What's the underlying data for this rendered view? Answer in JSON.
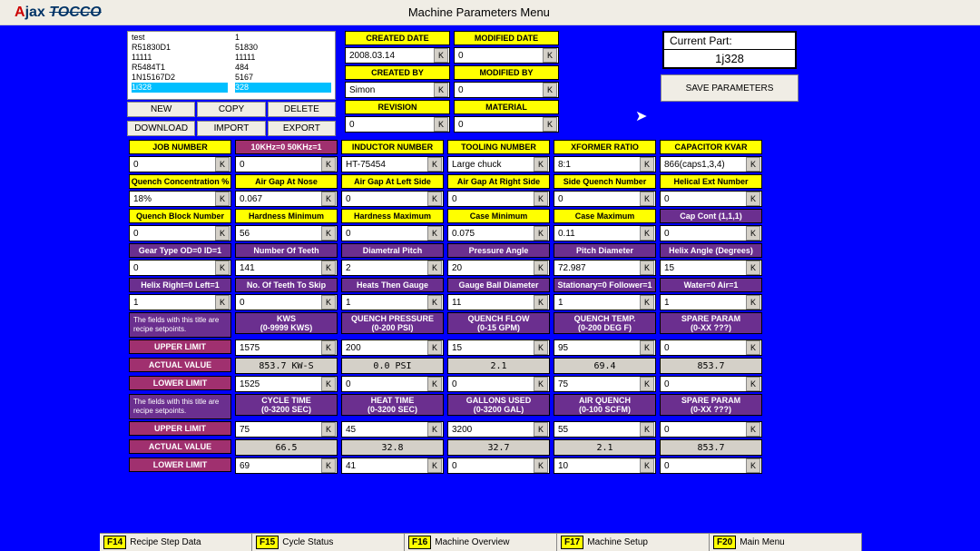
{
  "header": {
    "logo_a": "A",
    "logo_jax": "jax",
    "logo_tocco": "TOCCO",
    "title": "Machine Parameters Menu"
  },
  "recipe": {
    "col1": [
      "test",
      "R51830D1",
      "11111",
      "R5484T1",
      "1N15167D2"
    ],
    "col1_sel": "1i328",
    "col2": [
      "1",
      "51830",
      "11111",
      "484",
      "5167"
    ],
    "col2_sel": "328",
    "btn_new": "NEW",
    "btn_copy": "COPY",
    "btn_delete": "DELETE",
    "btn_download": "DOWNLOAD",
    "btn_import": "IMPORT",
    "btn_export": "EXPORT"
  },
  "meta": {
    "created_date_h": "CREATED DATE",
    "created_date": "2008.03.14",
    "modified_date_h": "MODIFIED DATE",
    "modified_date": "0",
    "created_by_h": "CREATED BY",
    "created_by": "Simon",
    "modified_by_h": "MODIFIED BY",
    "modified_by": "0",
    "revision_h": "REVISION",
    "revision": "0",
    "material_h": "MATERIAL",
    "material": "0"
  },
  "current": {
    "label": "Current Part:",
    "value": "1j328",
    "save": "SAVE PARAMETERS"
  },
  "k": "K",
  "row1h": [
    "JOB NUMBER",
    "10KHz=0  50KHz=1",
    "INDUCTOR NUMBER",
    "TOOLING NUMBER",
    "XFORMER RATIO",
    "CAPACITOR KVAR"
  ],
  "row1v": [
    "0",
    "0",
    "HT-75454",
    "Large chuck",
    "8:1",
    "866(caps1,3,4)"
  ],
  "row2h": [
    "Quench Concentration %",
    "Air Gap At Nose",
    "Air Gap At Left Side",
    "Air Gap At Right Side",
    "Side Quench Number",
    "Helical Ext Number"
  ],
  "row2v": [
    "18%",
    "0.067",
    "0",
    "0",
    "0",
    "0"
  ],
  "row3h": [
    "Quench Block Number",
    "Hardness Minimum",
    "Hardness Maximum",
    "Case Minimum",
    "Case Maximum",
    "Cap Cont (1,1,1)"
  ],
  "row3v": [
    "0",
    "56",
    "0",
    "0.075",
    "0.11",
    "0"
  ],
  "row4h": [
    "Gear Type OD=0 ID=1",
    "Number Of Teeth",
    "Diametral Pitch",
    "Pressure Angle",
    "Pitch Diameter",
    "Helix Angle (Degrees)"
  ],
  "row4v": [
    "0",
    "141",
    "2",
    "20",
    "72.987",
    "15"
  ],
  "row5h": [
    "Helix Right=0 Left=1",
    "No. Of Teeth To Skip",
    "Heats Then Gauge",
    "Gauge Ball Diameter",
    "Stationary=0 Follower=1",
    "Water=0 Air=1"
  ],
  "row5v": [
    "1",
    "0",
    "1",
    "11",
    "1",
    "1"
  ],
  "set1": {
    "note": "The fields with this title are recipe setpoints.",
    "cols": [
      "KWS\n(0-9999 KWS)",
      "QUENCH PRESSURE\n(0-200 PSI)",
      "QUENCH FLOW\n(0-15 GPM)",
      "QUENCH TEMP.\n(0-200 DEG F)",
      "SPARE PARAM\n(0-XX ???)"
    ],
    "upper_l": "UPPER LIMIT",
    "upper": [
      "1575",
      "200",
      "15",
      "95",
      "0"
    ],
    "actual_l": "ACTUAL VALUE",
    "actual": [
      "853.7 KW-S",
      "0.0 PSI",
      "2.1",
      "69.4",
      "853.7"
    ],
    "lower_l": "LOWER LIMIT",
    "lower": [
      "1525",
      "0",
      "0",
      "75",
      "0"
    ]
  },
  "set2": {
    "note": "The fields with this title are recipe setpoints.",
    "cols": [
      "CYCLE TIME\n(0-3200 SEC)",
      "HEAT TIME\n(0-3200 SEC)",
      "GALLONS USED\n(0-3200 GAL)",
      "AIR QUENCH\n(0-100 SCFM)",
      "SPARE PARAM\n(0-XX ???)"
    ],
    "upper_l": "UPPER LIMIT",
    "upper": [
      "75",
      "45",
      "3200",
      "55",
      "0"
    ],
    "actual_l": "ACTUAL VALUE",
    "actual": [
      "66.5",
      "32.8",
      "32.7",
      "2.1",
      "853.7"
    ],
    "lower_l": "LOWER LIMIT",
    "lower": [
      "69",
      "41",
      "0",
      "10",
      "0"
    ]
  },
  "footer": [
    {
      "f": "F14",
      "l": "Recipe Step Data"
    },
    {
      "f": "F15",
      "l": "Cycle Status"
    },
    {
      "f": "F16",
      "l": "Machine Overview"
    },
    {
      "f": "F17",
      "l": "Machine Setup"
    },
    {
      "f": "F20",
      "l": "Main Menu"
    }
  ]
}
